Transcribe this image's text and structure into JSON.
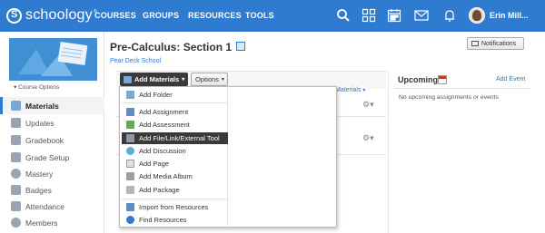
{
  "topnav": {
    "brand": "schoology",
    "brand_mark": "®",
    "items": [
      "COURSES",
      "GROUPS",
      "RESOURCES",
      "TOOLS"
    ],
    "icons": [
      "search-icon",
      "apps-grid-icon",
      "calendar-icon",
      "mail-icon",
      "notifications-icon"
    ],
    "user_name": "Erin Mill..."
  },
  "sidebar": {
    "course_options": "Course Options",
    "items": [
      {
        "label": "Materials",
        "icon": "materials-icon",
        "active": true
      },
      {
        "label": "Updates",
        "icon": "updates-icon"
      },
      {
        "label": "Gradebook",
        "icon": "gradebook-icon"
      },
      {
        "label": "Grade Setup",
        "icon": "grade-setup-icon"
      },
      {
        "label": "Mastery",
        "icon": "mastery-icon"
      },
      {
        "label": "Badges",
        "icon": "badges-icon"
      },
      {
        "label": "Attendance",
        "icon": "attendance-icon"
      },
      {
        "label": "Members",
        "icon": "members-icon"
      }
    ]
  },
  "main": {
    "title": "Pre-Calculus: Section 1",
    "school": "Pear Deck School",
    "notifications_label": "Notifications",
    "add_materials_label": "Add Materials",
    "options_label": "Options",
    "materials_link": "Materials",
    "dash": "-"
  },
  "dropdown": {
    "items": [
      {
        "label": "Add Folder",
        "icon": "folder-icon",
        "color": "#7aa7d6"
      },
      {
        "label": "Add Assignment",
        "icon": "assignment-icon",
        "color": "#5b8ec9"
      },
      {
        "label": "Add Assessment",
        "icon": "assessment-icon",
        "color": "#6aa84f"
      },
      {
        "label": "Add File/Link/External Tool",
        "icon": "file-link-icon",
        "color": "#8e9aa6",
        "highlighted": true
      },
      {
        "label": "Add Discussion",
        "icon": "discussion-icon",
        "color": "#5dade2"
      },
      {
        "label": "Add Page",
        "icon": "page-icon",
        "color": "#e0e0e0"
      },
      {
        "label": "Add Media Album",
        "icon": "media-album-icon",
        "color": "#9e9e9e"
      },
      {
        "label": "Add Package",
        "icon": "package-icon",
        "color": "#aab7c4"
      },
      {
        "label": "Import from Resources",
        "icon": "import-icon",
        "color": "#5b8ec9"
      },
      {
        "label": "Find Resources",
        "icon": "find-resources-icon",
        "color": "#2e7bcf"
      }
    ]
  },
  "upcoming": {
    "title": "Upcoming",
    "add_event": "Add Event",
    "empty": "No upcoming assignments or events"
  }
}
